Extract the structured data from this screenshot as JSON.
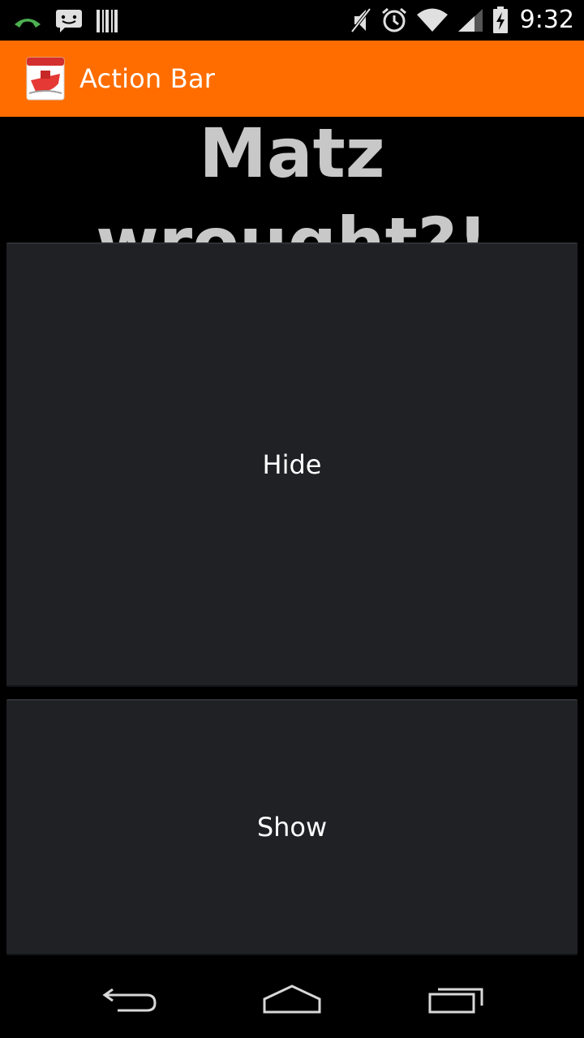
{
  "status_bar": {
    "time": "9:32",
    "left_icons": [
      "phone-call-icon",
      "sms-icon",
      "barcode-icon"
    ],
    "right_icons": [
      "mute-icon",
      "alarm-icon",
      "wifi-icon",
      "signal-icon",
      "battery-charging-icon"
    ]
  },
  "action_bar": {
    "title": "Action Bar",
    "app_icon": "ruboto-app-icon",
    "color": "#ff6d00"
  },
  "content": {
    "headline": "What hath Matz wrought?!",
    "hide_button_label": "Hide",
    "show_button_label": "Show"
  },
  "nav_bar": {
    "icons": [
      "back-icon",
      "home-icon",
      "recents-icon"
    ]
  },
  "colors": {
    "background": "#000000",
    "button_background": "#1f2125",
    "headline_text": "#c8c8c8",
    "accent": "#ff6d00"
  }
}
